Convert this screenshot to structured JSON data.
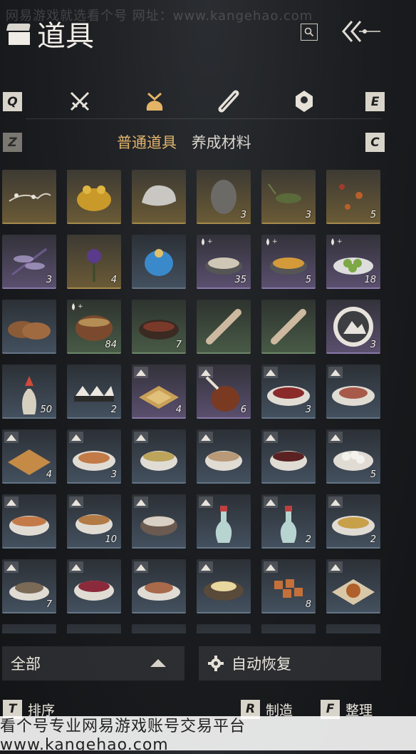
{
  "watermark_top": "网易游戏就选看个号   网址：www.kangehao.com",
  "header": {
    "title": "道具"
  },
  "keys": {
    "prev_cat": "Q",
    "next_cat": "E",
    "prev_sub": "Z",
    "next_sub": "C"
  },
  "category_tabs": [
    {
      "name": "weapons",
      "icon": "crossed-swords-icon"
    },
    {
      "name": "items",
      "icon": "pouch-icon"
    },
    {
      "name": "scrolls",
      "icon": "scroll-icon"
    },
    {
      "name": "misc",
      "icon": "gem-icon"
    }
  ],
  "subtabs": [
    {
      "label": "普通道具",
      "active": true
    },
    {
      "label": "养成材料",
      "active": false
    }
  ],
  "items": [
    {
      "art": "branch",
      "q": "gold",
      "qty": ""
    },
    {
      "art": "toad",
      "q": "gold",
      "qty": ""
    },
    {
      "art": "rock-white",
      "q": "gold",
      "qty": ""
    },
    {
      "art": "rock-grey",
      "q": "gold",
      "qty": "3"
    },
    {
      "art": "cricket",
      "q": "gold",
      "qty": "3"
    },
    {
      "art": "insects",
      "q": "gold",
      "qty": "5"
    },
    {
      "art": "dragonfly",
      "q": "purple",
      "qty": "3"
    },
    {
      "art": "flower",
      "q": "gold",
      "qty": "4"
    },
    {
      "art": "blue-pouch",
      "q": "blue",
      "qty": ""
    },
    {
      "art": "soup-white",
      "q": "purple",
      "qty": "35",
      "badge": "drop"
    },
    {
      "art": "soup-yellow",
      "q": "purple",
      "qty": "5",
      "badge": "drop"
    },
    {
      "art": "plate-green",
      "q": "purple",
      "qty": "18",
      "badge": "drop"
    },
    {
      "art": "bread",
      "q": "blue",
      "qty": ""
    },
    {
      "art": "claypot",
      "q": "green",
      "qty": "84",
      "badge": "drop"
    },
    {
      "art": "stew",
      "q": "green",
      "qty": "7"
    },
    {
      "art": "scroll",
      "q": "green",
      "qty": ""
    },
    {
      "art": "scroll",
      "q": "green",
      "qty": ""
    },
    {
      "art": "mountain-coin",
      "q": "purple",
      "qty": "3"
    },
    {
      "art": "vase",
      "q": "blue",
      "qty": "50"
    },
    {
      "art": "dumplings",
      "q": "blue",
      "qty": "2"
    },
    {
      "art": "noodles",
      "q": "purple",
      "qty": "4",
      "badge": "mount"
    },
    {
      "art": "ham",
      "q": "purple",
      "qty": "6",
      "badge": "mount"
    },
    {
      "art": "meat-plate",
      "q": "blue",
      "qty": "3",
      "badge": "mount"
    },
    {
      "art": "pork-plate",
      "q": "blue",
      "qty": "",
      "badge": "mount"
    },
    {
      "art": "cake",
      "q": "blue",
      "qty": "4",
      "badge": "mount"
    },
    {
      "art": "pancake",
      "q": "blue",
      "qty": "3",
      "badge": "mount"
    },
    {
      "art": "noodle-bowl",
      "q": "blue",
      "qty": "",
      "badge": "mount"
    },
    {
      "art": "porridge",
      "q": "blue",
      "qty": "",
      "badge": "mount"
    },
    {
      "art": "red-soup",
      "q": "blue",
      "qty": "",
      "badge": "mount"
    },
    {
      "art": "rice-balls",
      "q": "blue",
      "qty": "5",
      "badge": "mount"
    },
    {
      "art": "soup-bowl",
      "q": "blue",
      "qty": "",
      "badge": "mount"
    },
    {
      "art": "tea-bowl",
      "q": "blue",
      "qty": "10",
      "badge": "mount"
    },
    {
      "art": "rice-bowl",
      "q": "blue",
      "qty": "",
      "badge": "mount"
    },
    {
      "art": "bottle",
      "q": "blue",
      "qty": "",
      "badge": "mount"
    },
    {
      "art": "bottle",
      "q": "blue",
      "qty": "2",
      "badge": "mount"
    },
    {
      "art": "noodle-plate",
      "q": "blue",
      "qty": "2",
      "badge": "mount"
    },
    {
      "art": "fish-plate",
      "q": "blue",
      "qty": "7",
      "badge": "mount"
    },
    {
      "art": "berry-bowl",
      "q": "blue",
      "qty": "",
      "badge": "mount"
    },
    {
      "art": "sliced-meat",
      "q": "blue",
      "qty": "",
      "badge": "mount"
    },
    {
      "art": "egg-dish",
      "q": "blue",
      "qty": "",
      "badge": "mount"
    },
    {
      "art": "tofu",
      "q": "blue",
      "qty": "8",
      "badge": "mount"
    },
    {
      "art": "fried-snack",
      "q": "blue",
      "qty": "",
      "badge": "mount"
    }
  ],
  "filter": {
    "label": "全部"
  },
  "auto_restore": {
    "label": "自动恢复"
  },
  "bottom_actions": [
    {
      "key": "T",
      "label": "排序"
    },
    {
      "key": "R",
      "label": "制造"
    },
    {
      "key": "F",
      "label": "整理"
    }
  ],
  "footer_watermark": "看个号专业网易游戏账号交易平台  www.kangehao.com"
}
